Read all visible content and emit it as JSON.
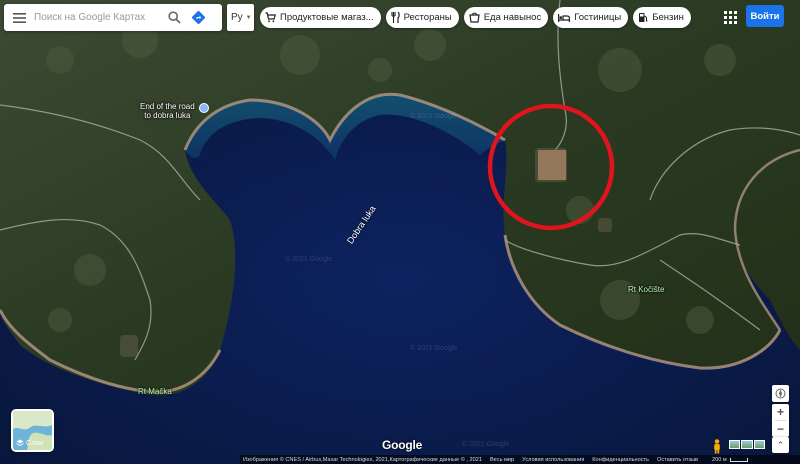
{
  "search": {
    "placeholder": "Поиск на Google Картах"
  },
  "language_button": {
    "label": "Ру"
  },
  "chips": [
    {
      "label": "Продуктовые магаз...",
      "icon": "cart-icon"
    },
    {
      "label": "Рестораны",
      "icon": "fork-knife-icon"
    },
    {
      "label": "Еда навынос",
      "icon": "takeout-icon"
    },
    {
      "label": "Гостиницы",
      "icon": "bed-icon"
    },
    {
      "label": "Бензин",
      "icon": "fuel-icon"
    }
  ],
  "sign_in_label": "Войти",
  "map_labels": {
    "road_end": "End of the road\nto dobra luka",
    "bay": "Dobra luka",
    "cape_east": "Rt Kočište",
    "cape_west": "Rt Mačka"
  },
  "watermarks": [
    "© 2021 Google",
    "© 2021 Google",
    "© 2021 Google",
    "© 2021 Google"
  ],
  "layers_label": "Слои",
  "google_logo": "Google",
  "footer": {
    "attribution": "Изображения © CNES / Airbus,Maxar Technologies, 2021,Картографические данные © , 2021",
    "links": [
      "Весь мир",
      "Условия использования",
      "Конфиденциальность",
      "Оставить отзыв"
    ],
    "scale": "200 м"
  },
  "highlight": {
    "color": "#e0141c",
    "shape": "circle"
  },
  "colors": {
    "sign_in": "#1a73e8",
    "water": "#0e2a66",
    "land": "#2b3b22"
  }
}
